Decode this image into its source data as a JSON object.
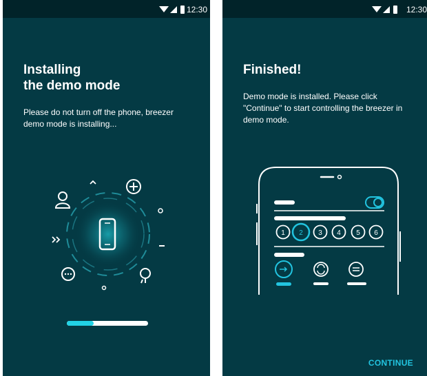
{
  "install_screen": {
    "status_time": "12:30",
    "title_line1": "Installing",
    "title_line2": "the demo mode",
    "message": "Please do not turn off the phone, breezer demo mode is installing...",
    "progress": 0.33,
    "icons": [
      "person-icon",
      "chevron-up-icon",
      "plus-circle-icon",
      "double-chevron-icon",
      "chat-icon",
      "lightbulb-icon",
      "phone-icon"
    ]
  },
  "finished_screen": {
    "status_time": "12:30",
    "title": "Finished!",
    "message": "Demo mode is installed. Please click \"Continue\" to start controlling the breezer in demo mode.",
    "speed_options": [
      "1",
      "2",
      "3",
      "4",
      "5",
      "6"
    ],
    "selected_speed": "2",
    "continue_label": "CONTINUE"
  },
  "colors": {
    "background": "#043a44",
    "status_bar": "#012329",
    "accent": "#22d3e6"
  }
}
